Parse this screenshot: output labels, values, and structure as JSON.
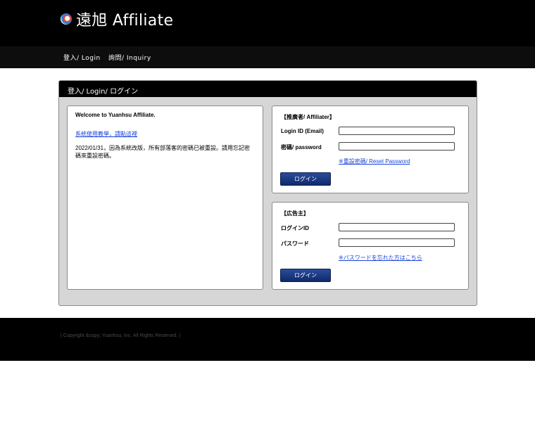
{
  "brand": {
    "name": "遠旭 Affiliate",
    "logo_icon": "logo-mark-icon"
  },
  "nav": [
    {
      "label": "登入/ Login"
    },
    {
      "label": "詢問/ Inquiry"
    }
  ],
  "panel": {
    "title": "登入/ Login/ ログイン",
    "info": {
      "welcome": "Welcome to Yuanhsu Affiliate.",
      "guide_link": "系統使用教學，請點這裡",
      "notice": "2022/01/31，因為系統改版，所有部落客的密碼已被重設。請用忘記密碼來重設密碼。"
    },
    "affiliater": {
      "title": "【推廣者/ Affiliater】",
      "login_label": "Login ID (Email)",
      "login_value": "",
      "password_label": "密碼/ password",
      "password_value": "",
      "reset_link": "※重設密碼/ Reset Password",
      "button": "ログイン"
    },
    "advertiser": {
      "title": "【広告主】",
      "login_label": "ログインID",
      "login_value": "",
      "password_label": "パスワード",
      "password_value": "",
      "reset_link": "※パスワードを忘れた方はこちら",
      "button": "ログイン"
    }
  },
  "footer": {
    "copyright": "| Copyright &copy; Yuanhsu, Inc. All Rights Reserved. |"
  }
}
